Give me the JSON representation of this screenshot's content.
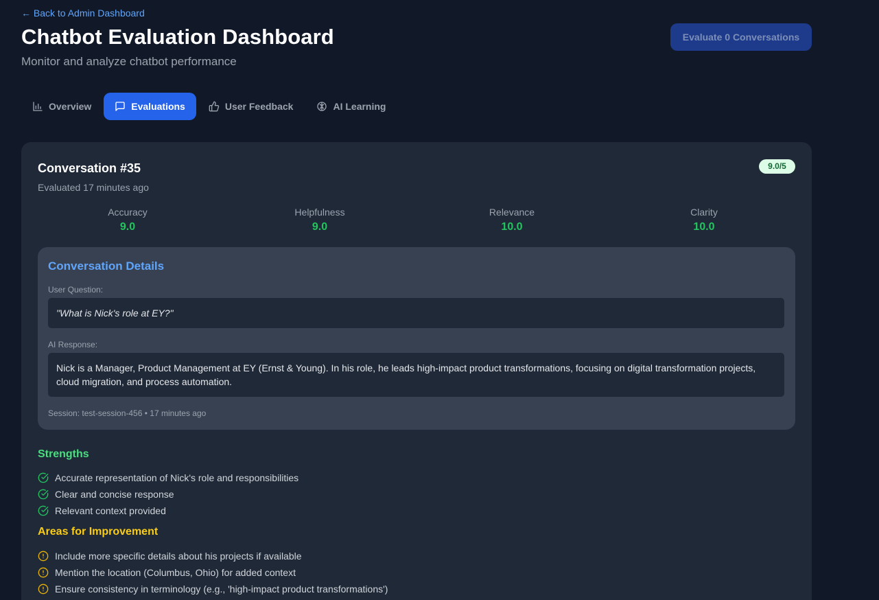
{
  "header": {
    "back_link": "← Back to Admin Dashboard",
    "title": "Chatbot Evaluation Dashboard",
    "subtitle": "Monitor and analyze chatbot performance",
    "evaluate_button": "Evaluate 0 Conversations"
  },
  "tabs": [
    {
      "label": "Overview",
      "icon": "bar-chart-icon",
      "active": false
    },
    {
      "label": "Evaluations",
      "icon": "message-square-icon",
      "active": true
    },
    {
      "label": "User Feedback",
      "icon": "thumbs-up-icon",
      "active": false
    },
    {
      "label": "AI Learning",
      "icon": "brain-icon",
      "active": false
    }
  ],
  "conversation": {
    "title": "Conversation #35",
    "evaluated": "Evaluated 17 minutes ago",
    "score_badge": "9.0/5",
    "metrics": [
      {
        "label": "Accuracy",
        "value": "9.0"
      },
      {
        "label": "Helpfulness",
        "value": "9.0"
      },
      {
        "label": "Relevance",
        "value": "10.0"
      },
      {
        "label": "Clarity",
        "value": "10.0"
      }
    ],
    "details": {
      "title": "Conversation Details",
      "question_label": "User Question:",
      "question": "\"What is Nick's role at EY?\"",
      "response_label": "AI Response:",
      "response": "Nick is a Manager, Product Management at EY (Ernst & Young). In his role, he leads high-impact product transformations, focusing on digital transformation projects, cloud migration, and process automation.",
      "session": "Session: test-session-456 • 17 minutes ago"
    },
    "strengths_title": "Strengths",
    "strengths": [
      "Accurate representation of Nick's role and responsibilities",
      "Clear and concise response",
      "Relevant context provided"
    ],
    "improvements_title": "Areas for Improvement",
    "improvements": [
      "Include more specific details about his projects if available",
      "Mention the location (Columbus, Ohio) for added context",
      "Ensure consistency in terminology (e.g., 'high-impact product transformations')"
    ]
  },
  "colors": {
    "background": "#111827",
    "card": "#1f2937",
    "accent": "#2563eb",
    "success": "#22c55e",
    "warning": "#facc15"
  }
}
